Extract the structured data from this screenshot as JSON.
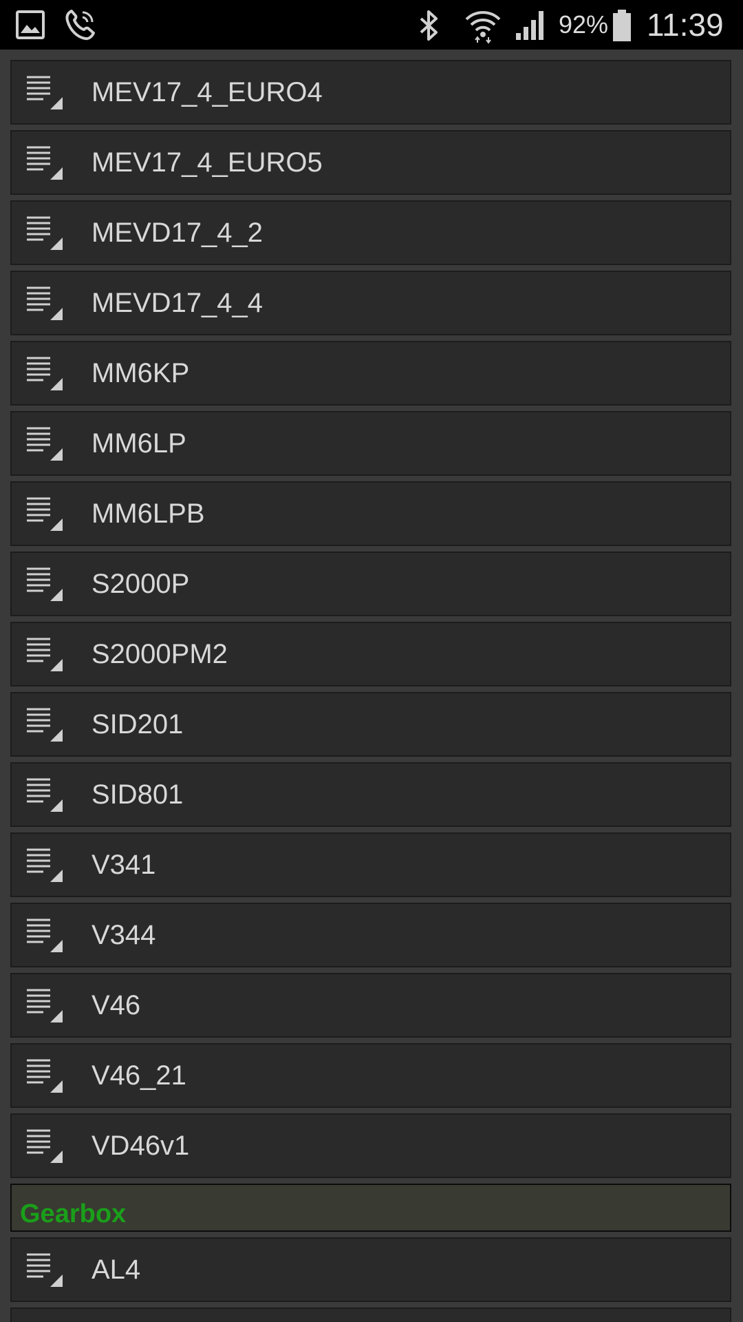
{
  "status_bar": {
    "battery_percent": "92%",
    "time": "11:39",
    "icons": [
      "gallery-icon",
      "phone-call-icon",
      "bluetooth-icon",
      "wifi-icon",
      "signal-icon",
      "battery-icon"
    ]
  },
  "list": {
    "items": [
      {
        "label": "MEV17_4_EURO4",
        "icon": "list-item-icon"
      },
      {
        "label": "MEV17_4_EURO5",
        "icon": "list-item-icon"
      },
      {
        "label": "MEVD17_4_2",
        "icon": "list-item-icon"
      },
      {
        "label": "MEVD17_4_4",
        "icon": "list-item-icon"
      },
      {
        "label": "MM6KP",
        "icon": "list-item-icon"
      },
      {
        "label": "MM6LP",
        "icon": "list-item-icon"
      },
      {
        "label": "MM6LPB",
        "icon": "list-item-icon"
      },
      {
        "label": "S2000P",
        "icon": "list-item-icon"
      },
      {
        "label": "S2000PM2",
        "icon": "list-item-icon"
      },
      {
        "label": "SID201",
        "icon": "list-item-icon"
      },
      {
        "label": "SID801",
        "icon": "list-item-icon"
      },
      {
        "label": "V341",
        "icon": "list-item-icon"
      },
      {
        "label": "V344",
        "icon": "list-item-icon"
      },
      {
        "label": "V46",
        "icon": "list-item-icon"
      },
      {
        "label": "V46_21",
        "icon": "list-item-icon"
      },
      {
        "label": "VD46v1",
        "icon": "list-item-icon"
      }
    ],
    "section": {
      "label": "Gearbox"
    },
    "section_items": [
      {
        "label": "AL4",
        "icon": "list-item-icon"
      }
    ]
  },
  "colors": {
    "section_label": "#1a9f1a",
    "row_background": "#2a2a2a",
    "text": "#d8d8d8"
  }
}
